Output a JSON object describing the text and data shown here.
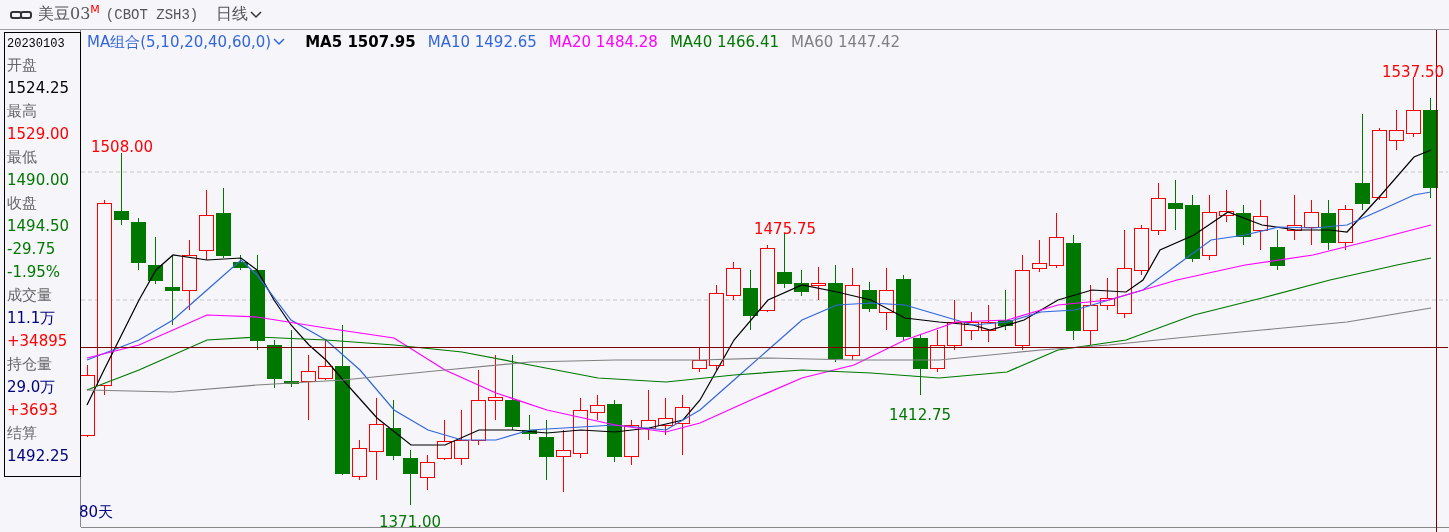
{
  "header": {
    "instrument": "美豆03",
    "instrument_mark": "M",
    "code": "(CBOT ZSH3)",
    "period": "日线"
  },
  "info_panel": {
    "date": "20230103",
    "lines": [
      {
        "kind": "label",
        "text": "开盘"
      },
      {
        "kind": "value",
        "text": "1524.25",
        "color": "#000000"
      },
      {
        "kind": "label",
        "text": "最高"
      },
      {
        "kind": "value",
        "text": "1529.00",
        "color": "#ff0000"
      },
      {
        "kind": "label",
        "text": "最低"
      },
      {
        "kind": "value",
        "text": "1490.00",
        "color": "#007800"
      },
      {
        "kind": "label",
        "text": "收盘"
      },
      {
        "kind": "value",
        "text": "1494.50",
        "color": "#007800"
      },
      {
        "kind": "value",
        "text": "-29.75",
        "color": "#007800"
      },
      {
        "kind": "value",
        "text": "-1.95%",
        "color": "#007800"
      },
      {
        "kind": "label",
        "text": "成交量"
      },
      {
        "kind": "value",
        "text": "11.1万",
        "color": "#000080"
      },
      {
        "kind": "value",
        "text": "+34895",
        "color": "#ff0000"
      },
      {
        "kind": "label",
        "text": "持仓量"
      },
      {
        "kind": "value",
        "text": "29.0万",
        "color": "#000080"
      },
      {
        "kind": "value",
        "text": "+3693",
        "color": "#ff0000"
      },
      {
        "kind": "label",
        "text": "结算"
      },
      {
        "kind": "value",
        "text": "1492.25",
        "color": "#000080"
      }
    ]
  },
  "chart": {
    "indicator": "MA组合(5,10,20,40,60,0)",
    "moving_averages": [
      {
        "name": "MA5",
        "value": "1507.95",
        "color": "#000000"
      },
      {
        "name": "MA10",
        "value": "1492.65",
        "color": "#3366dd"
      },
      {
        "name": "MA20",
        "value": "1484.28",
        "color": "#ff00ff"
      },
      {
        "name": "MA40",
        "value": "1466.41",
        "color": "#007800"
      },
      {
        "name": "MA60",
        "value": "1447.42",
        "color": "#808080"
      }
    ],
    "price_labels": [
      {
        "kind": "high",
        "text": "1508.00"
      },
      {
        "kind": "high",
        "text": "1475.75"
      },
      {
        "kind": "low",
        "text": "1412.75"
      },
      {
        "kind": "low",
        "text": "1371.00"
      },
      {
        "kind": "high",
        "text": "1537.50"
      }
    ],
    "range_label": "80天"
  }
}
